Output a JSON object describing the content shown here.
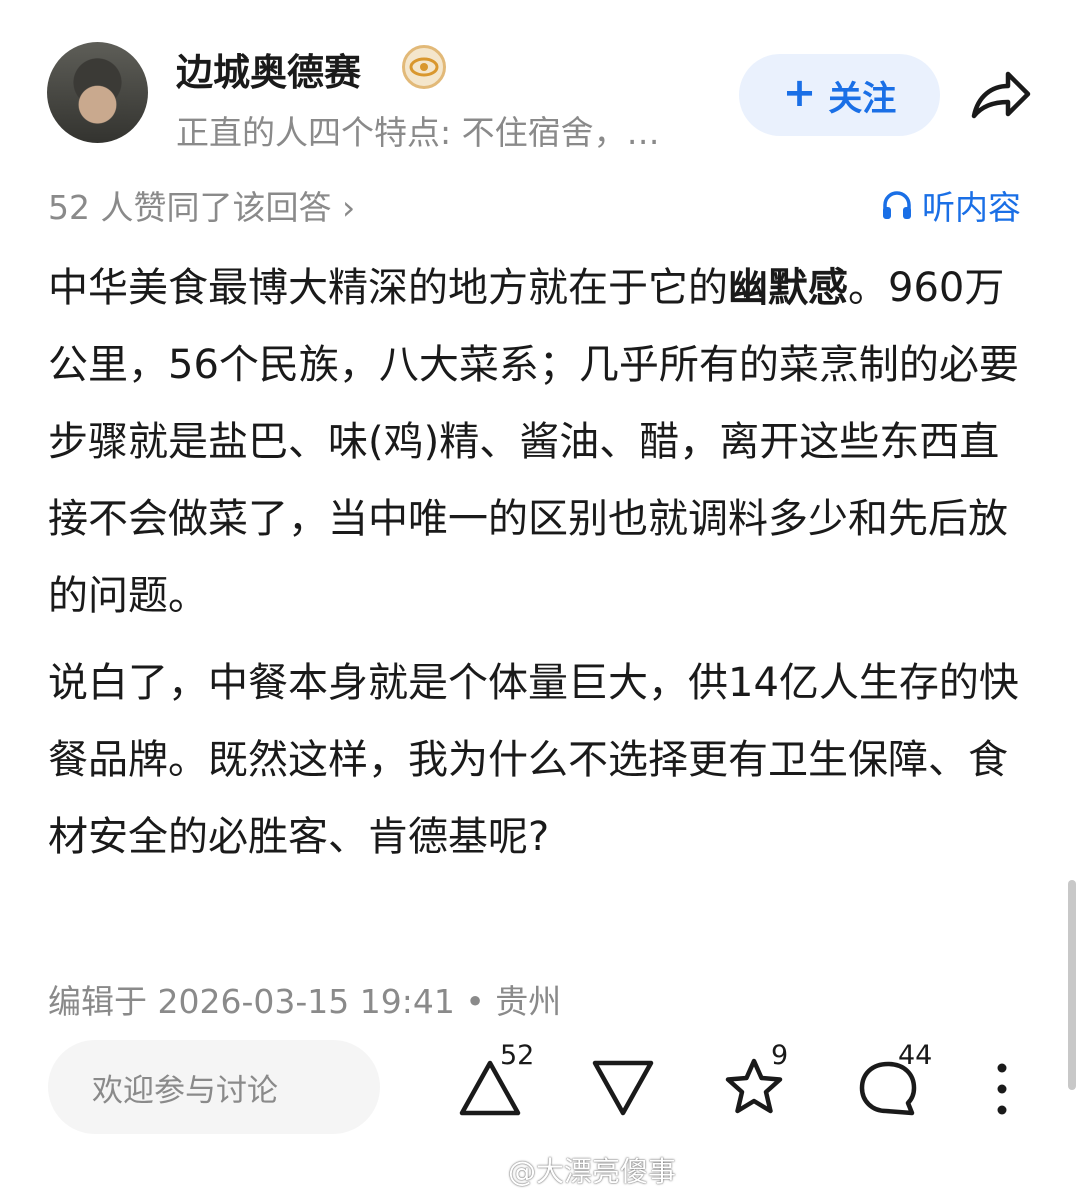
{
  "author": {
    "name": "边城奥德赛",
    "bio": "正直的人四个特点: 不住宿舍，…"
  },
  "header": {
    "follow_label": "关注"
  },
  "answer": {
    "upvote_summary": "52 人赞同了该回答 ›",
    "listen_label": "听内容",
    "para1_pre": "中华美食最博大精深的地方就在于它的",
    "para1_bold": "幽默感",
    "para1_post": "。960万公里，56个民族，八大菜系；几乎所有的菜烹制的必要步骤就是盐巴、味(鸡)精、酱油、醋，离开这些东西直接不会做菜了，当中唯一的区别也就调料多少和先后放的问题。",
    "para2": "说白了，中餐本身就是个体量巨大，供14亿人生存的快餐品牌。既然这样，我为什么不选择更有卫生保障、食材安全的必胜客、肯德基呢?",
    "edit_meta": "编辑于 2026-03-15 19:41 • 贵州"
  },
  "bottom_bar": {
    "comment_placeholder": "欢迎参与讨论",
    "upvote_count": "52",
    "favorite_count": "9",
    "comment_count": "44"
  },
  "watermark": "@大漂亮傻事",
  "colors": {
    "accent_blue": "#1a6fe6",
    "follow_bg": "#eaf1fd",
    "muted_text": "#8a8a8a"
  }
}
